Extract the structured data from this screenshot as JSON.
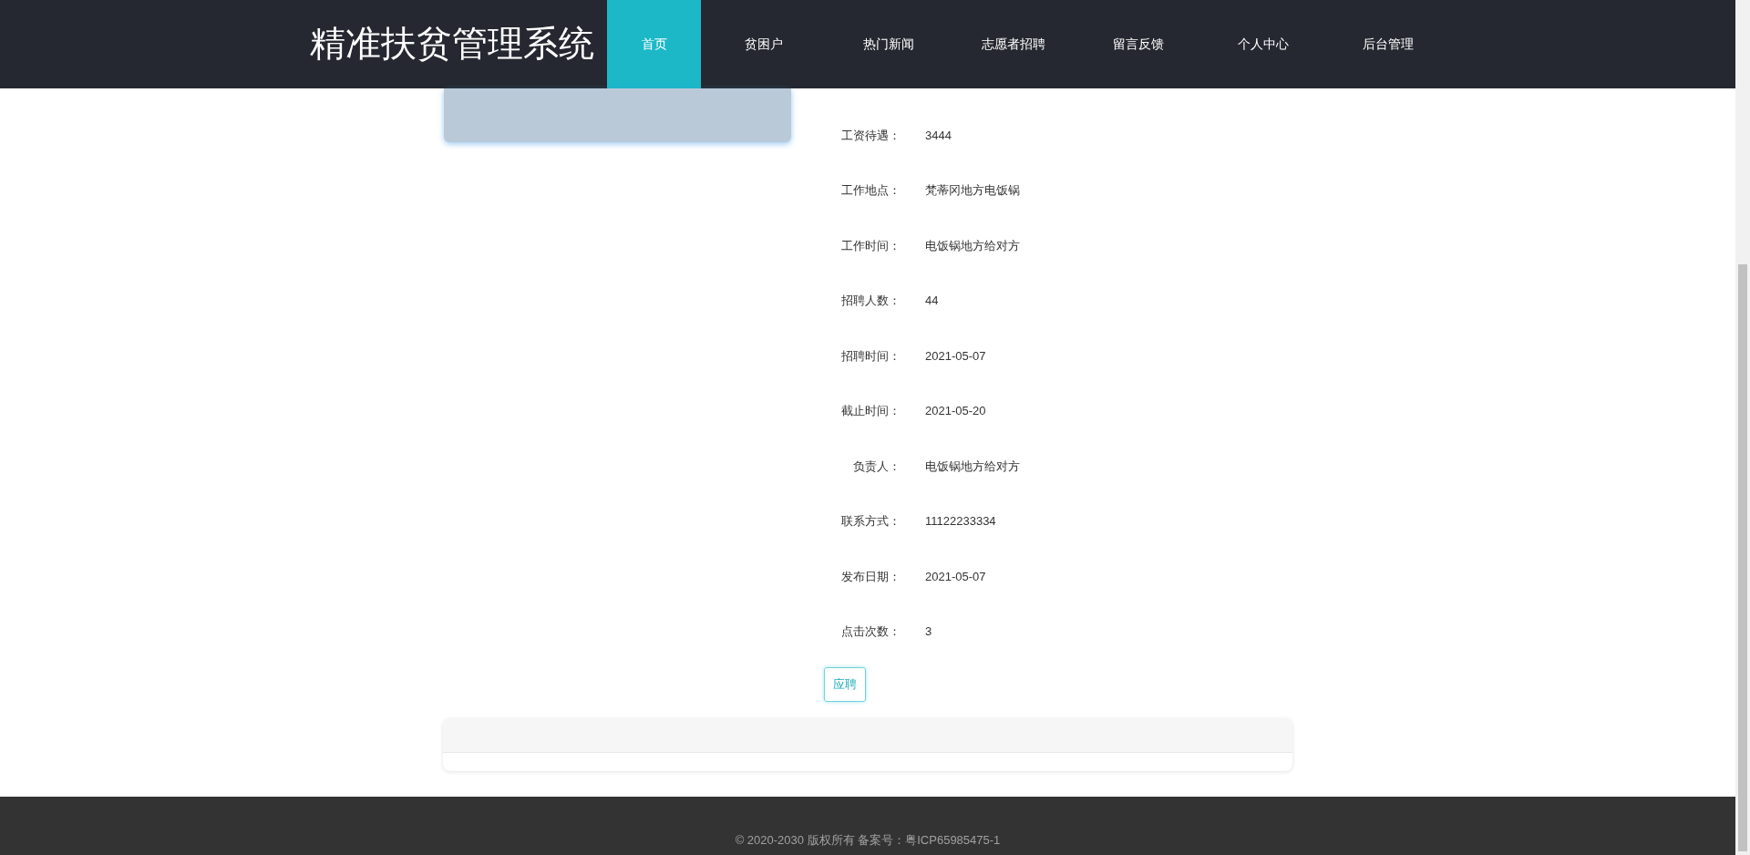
{
  "site_title": "精准扶贫管理系统",
  "nav": [
    {
      "label": "首页",
      "selected": true
    },
    {
      "label": "贫困户",
      "selected": false
    },
    {
      "label": "热门新闻",
      "selected": false
    },
    {
      "label": "志愿者招聘",
      "selected": false
    },
    {
      "label": "留言反馈",
      "selected": false
    },
    {
      "label": "个人中心",
      "selected": false
    },
    {
      "label": "后台管理",
      "selected": false
    }
  ],
  "details": [
    {
      "label": "工资待遇：",
      "value": "3444"
    },
    {
      "label": "工作地点：",
      "value": "梵蒂冈地方电饭锅"
    },
    {
      "label": "工作时间：",
      "value": "电饭锅地方给对方"
    },
    {
      "label": "招聘人数：",
      "value": "44"
    },
    {
      "label": "招聘时间：",
      "value": "2021-05-07"
    },
    {
      "label": "截止时间：",
      "value": "2021-05-20"
    },
    {
      "label": "负责人：",
      "value": "电饭锅地方给对方"
    },
    {
      "label": "联系方式：",
      "value": "11122233334"
    },
    {
      "label": "发布日期：",
      "value": "2021-05-07"
    },
    {
      "label": "点击次数：",
      "value": "3"
    }
  ],
  "apply_button": "应聘",
  "footer": "© 2020-2030 版权所有 备案号：粤ICP65985475-1"
}
